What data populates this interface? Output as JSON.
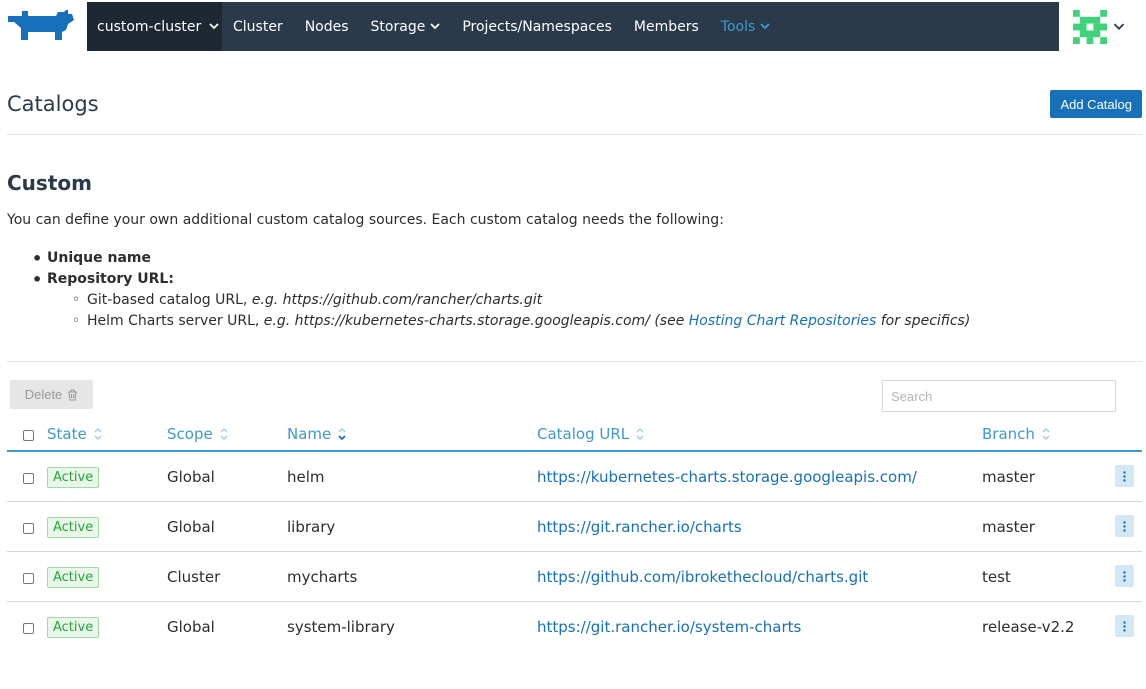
{
  "nav": {
    "cluster": "custom-cluster",
    "items": [
      "Cluster",
      "Nodes",
      "Storage",
      "Projects/Namespaces",
      "Members",
      "Tools"
    ],
    "accent": "#3d98d3",
    "bar_color": "#2b3a4a"
  },
  "header": {
    "title": "Catalogs",
    "add_button": "Add Catalog"
  },
  "custom": {
    "title": "Custom",
    "description": "You can define your own additional custom catalog sources. Each custom catalog needs the following:",
    "req_name": "Unique name",
    "req_repo": "Repository URL:",
    "git_prefix": "Git-based catalog URL, ",
    "git_example": "e.g. https://github.com/rancher/charts.git",
    "helm_prefix": "Helm Charts server URL, ",
    "helm_example": "e.g. https://kubernetes-charts.storage.googleapis.com/ (see ",
    "helm_link": "Hosting Chart Repositories",
    "helm_suffix": " for specifics)"
  },
  "toolbar": {
    "delete_label": "Delete",
    "search_placeholder": "Search"
  },
  "table": {
    "columns": [
      "State",
      "Scope",
      "Name",
      "Catalog URL",
      "Branch"
    ],
    "rows": [
      {
        "state": "Active",
        "scope": "Global",
        "name": "helm",
        "url": "https://kubernetes-charts.storage.googleapis.com/",
        "branch": "master"
      },
      {
        "state": "Active",
        "scope": "Global",
        "name": "library",
        "url": "https://git.rancher.io/charts",
        "branch": "master"
      },
      {
        "state": "Active",
        "scope": "Cluster",
        "name": "mycharts",
        "url": "https://github.com/ibrokethecloud/charts.git",
        "branch": "test"
      },
      {
        "state": "Active",
        "scope": "Global",
        "name": "system-library",
        "url": "https://git.rancher.io/system-charts",
        "branch": "release-v2.2"
      }
    ]
  }
}
